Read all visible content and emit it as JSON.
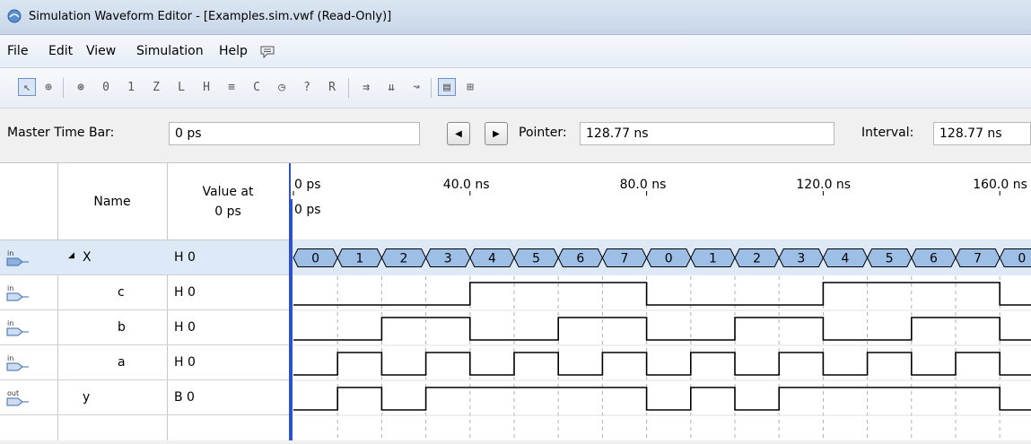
{
  "window": {
    "title": "Simulation Waveform Editor - [Examples.sim.vwf (Read-Only)]"
  },
  "menu": {
    "items": [
      "File",
      "Edit",
      "View",
      "Simulation",
      "Help"
    ]
  },
  "toolbar": {
    "icons": [
      "select-pointer-icon",
      "zoom-icon",
      "uninitialized-icon",
      "force-low-icon",
      "force-high-icon",
      "high-impedance-icon",
      "weak-low-icon",
      "weak-high-icon",
      "invert-icon",
      "count-value-icon",
      "overwrite-clock-icon",
      "random-values-icon",
      "snap-to-grid-icon",
      "snap-transition-icon",
      "arbitrary-value-icon",
      "grid-setting-icon",
      "simulation-settings-icon"
    ]
  },
  "timebar": {
    "master_label": "Master Time Bar:",
    "master_value": "0 ps",
    "pointer_label": "Pointer:",
    "pointer_value": "128.77 ns",
    "interval_label": "Interval:",
    "interval_value": "128.77 ns"
  },
  "table": {
    "name_header": "Name",
    "value_header_line1": "Value at",
    "value_header_line2": "0 ps",
    "rows": [
      {
        "direction": "in",
        "expand": "◢",
        "name": "X",
        "value": "H 0"
      },
      {
        "direction": "in",
        "name": "c",
        "value": "H 0"
      },
      {
        "direction": "in",
        "name": "b",
        "value": "H 0"
      },
      {
        "direction": "in",
        "name": "a",
        "value": "H 0"
      },
      {
        "direction": "out",
        "name": "y",
        "value": "B 0"
      }
    ]
  },
  "timeline": {
    "ticks": [
      "0 ps",
      "40.0 ns",
      "80.0 ns",
      "120.0 ns",
      "160.0 ns"
    ],
    "cursor_label": "0 ps"
  },
  "waveforms": {
    "period_ns": 10,
    "bus_X": [
      "0",
      "1",
      "2",
      "3",
      "4",
      "5",
      "6",
      "7",
      "0",
      "1",
      "2",
      "3",
      "4",
      "5",
      "6",
      "7",
      "0"
    ],
    "c": [
      0,
      0,
      0,
      0,
      1,
      1,
      1,
      1,
      0,
      0,
      0,
      0,
      1,
      1,
      1,
      1,
      0
    ],
    "b": [
      0,
      0,
      1,
      1,
      0,
      0,
      1,
      1,
      0,
      0,
      1,
      1,
      0,
      0,
      1,
      1,
      0
    ],
    "a": [
      0,
      1,
      0,
      1,
      0,
      1,
      0,
      1,
      0,
      1,
      0,
      1,
      0,
      1,
      0,
      1,
      0
    ],
    "y": [
      0,
      1,
      0,
      1,
      1,
      1,
      1,
      1,
      0,
      1,
      0,
      1,
      1,
      1,
      1,
      1,
      0
    ]
  },
  "colors": {
    "bus_fill": "#9dbfe6",
    "cursor": "#3050c8"
  }
}
